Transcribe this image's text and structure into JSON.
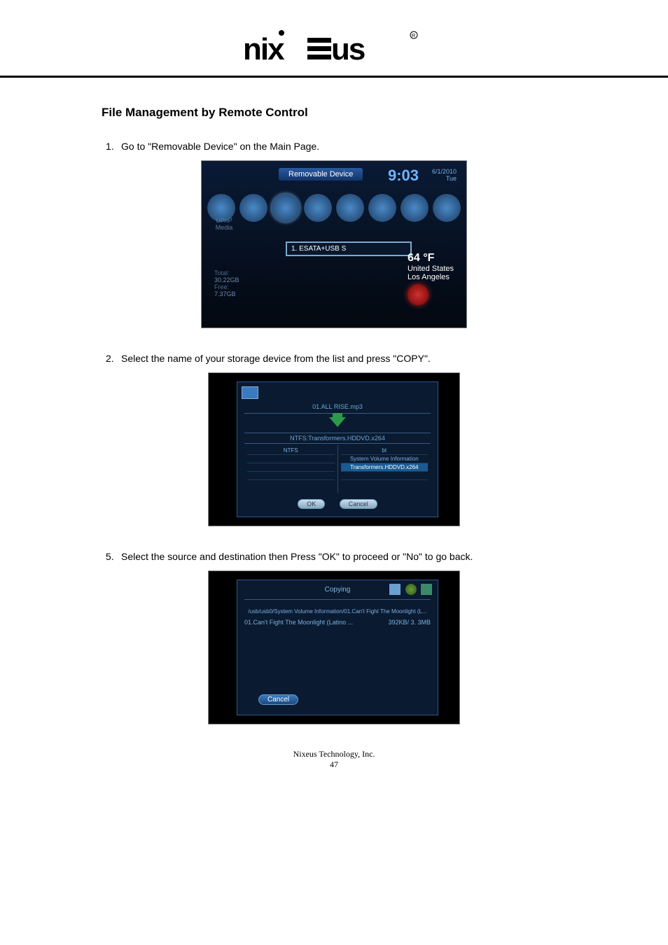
{
  "logo_alt": "nixeus",
  "heading": "File Management by Remote Control",
  "steps": {
    "s1": {
      "num": "1.",
      "text": "Go to \"Removable Device\" on the Main Page."
    },
    "s2": {
      "num": "2.",
      "text": "Select the name of your storage device from the list and press \"COPY\"."
    },
    "s5": {
      "num": "5.",
      "text": "Select the source and destination then Press \"OK\" to proceed or \"No\" to go back."
    }
  },
  "shot1": {
    "tab": "Removable Device",
    "clock": "9:03",
    "date_line1": "6/1/2010",
    "date_line2": "Tue",
    "upnp_label": "UPnP",
    "upnp_sub": "Media",
    "device": "1. ESATA+USB S",
    "total_label": "Total:",
    "total_val": "30.22GB",
    "free_label": "Free:",
    "free_val": "7.37GB",
    "temp": "64 °F",
    "loc1": "United States",
    "loc2": "Los Angeles"
  },
  "shot2": {
    "src_file": "01.ALL RISE.mp3",
    "dest_path": "NTFS:Transformers.HDDVD.x264",
    "left_label": "NTFS",
    "right_rows": {
      "r1": "bt",
      "r2": "System Volume Information",
      "r3": "Transformers.HDDVD.x264"
    },
    "ok": "OK",
    "cancel": "Cancel"
  },
  "shot3": {
    "title": "Copying",
    "path": "/usb/usb0/System Volume Information/01.Can't Fight The Moonlight (L...",
    "file_name": "01.Can't Fight The Moonlight (Latino ...",
    "file_size": "392KB/ 3. 3MB",
    "cancel": "Cancel"
  },
  "footer": {
    "company": "Nixeus Technology, Inc.",
    "page": "47"
  }
}
